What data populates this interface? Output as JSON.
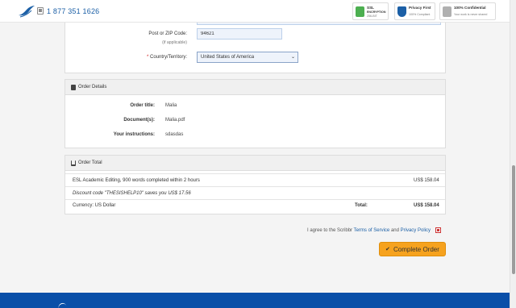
{
  "header": {
    "logo_icon": "scribbr-bird-logo",
    "phone": "1 877 351 1626",
    "badges": [
      {
        "line1": "SSL",
        "line2": "ENCRYPTION",
        "line3": "256-BIT",
        "icon": "ssl-check-icon",
        "color": "#4caf50"
      },
      {
        "line1": "Privacy First",
        "line2": "100% Compliant",
        "icon": "shield-icon",
        "color": "#1b5fa6"
      },
      {
        "line1": "100% Confidential",
        "line2": "Your work is never shared",
        "icon": "lock-icon",
        "color": "#b0b0b0"
      }
    ]
  },
  "address": {
    "postal_label": "Post or ZIP Code:",
    "postal_note": "(if applicable)",
    "postal_value": "94621",
    "country_required_mark": "*",
    "country_label": "Country/Territory:",
    "country_value": "United States of America"
  },
  "order_details": {
    "title": "Order Details",
    "rows": [
      {
        "label": "Order title:",
        "value": "Malia"
      },
      {
        "label": "Document(s):",
        "value": "Malia.pdf"
      },
      {
        "label": "Your instructions:",
        "value": "sdasdas"
      }
    ]
  },
  "order_total": {
    "title": "Order Total",
    "line_item": "ESL Academic Editing, 900 words completed within 2 hours",
    "line_price": "US$ 158.04",
    "discount": "Discount code \"THESISHELP10\" saves you US$ 17.56",
    "currency": "Currency: US Dollar",
    "total_label": "Total:",
    "total_value": "US$ 158.04"
  },
  "agree": {
    "prefix": "I agree to the Scribbr",
    "tos": "Terms of Service",
    "and": "and",
    "privacy": "Privacy Policy",
    "checked": true
  },
  "complete_button": "Complete Order"
}
